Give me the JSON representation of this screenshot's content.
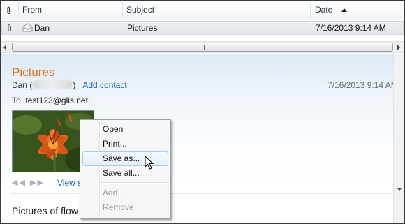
{
  "message_list": {
    "columns": {
      "attachment": "attachment-column-icon",
      "from": "From",
      "subject": "Subject",
      "date": "Date"
    },
    "sort": "descending-by-date",
    "rows": [
      {
        "has_attachment": true,
        "read": true,
        "from": "Dan",
        "subject": "Pictures",
        "date": "7/16/2013 9:14 AM"
      }
    ]
  },
  "reading_pane": {
    "subject": "Pictures",
    "from_name": "Dan",
    "open_paren": "(",
    "close_paren": ")",
    "add_contact": "Add contact",
    "date": "7/16/2013 9:14 AM",
    "to_label": "To:",
    "to_address": "test123@glis.net;",
    "nav_arrows": "◀◀   ▶▶",
    "view_link": "View s",
    "body_preview": "Pictures of flow"
  },
  "context_menu": {
    "items": [
      {
        "label": "Open",
        "enabled": true,
        "highlighted": false
      },
      {
        "label": "Print...",
        "enabled": true,
        "highlighted": false
      },
      {
        "label": "Save as...",
        "enabled": true,
        "highlighted": true
      },
      {
        "label": "Save all...",
        "enabled": true,
        "highlighted": false
      },
      {
        "label": "Add...",
        "enabled": false,
        "highlighted": false
      },
      {
        "label": "Remove",
        "enabled": false,
        "highlighted": false
      }
    ]
  },
  "colors": {
    "subject_orange": "#e66f12",
    "link_blue": "#1b63b5",
    "highlight_border": "#aac9ec"
  }
}
